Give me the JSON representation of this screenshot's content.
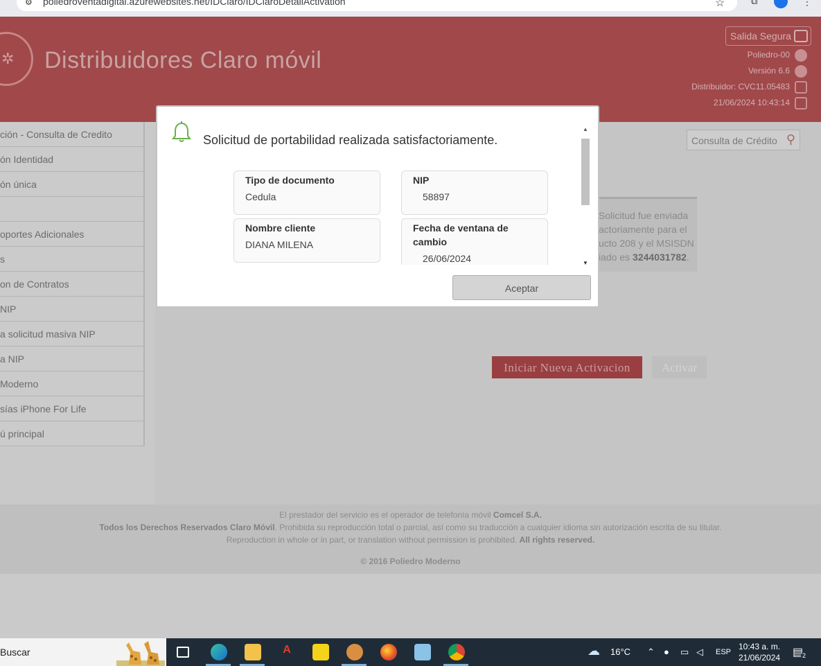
{
  "browser": {
    "url": "poliedroventadigital.azurewebsites.net/IDClaro/IDClaroDetailActivation"
  },
  "header": {
    "site_title": "Distribuidores Claro móvil",
    "logout_label": "Salida Segura",
    "info": [
      "Poliedro-00",
      "Versión 6.6",
      "Distribuidor: CVC11.05483",
      "21/06/2024 10:43:14"
    ]
  },
  "sidebar": {
    "items": [
      "ción - Consulta de Credito",
      "ón Identidad",
      "ón única",
      "",
      "oportes Adicionales",
      "s",
      "on de Contratos",
      " NIP",
      "a solicitud masiva NIP",
      "a NIP",
      " Moderno",
      "sías iPhone For Life",
      "ú principal"
    ]
  },
  "main": {
    "consulta_label": "Consulta de Crédito",
    "message_lines": [
      "Solicitud fue enviada",
      "actoriamente para el",
      "ucto 208 y el MSISDN"
    ],
    "message_prefix": "iado es ",
    "message_msisdn": "3244031782",
    "message_suffix": ".",
    "btn_iniciar": "Iniciar Nueva Activacion",
    "btn_activar": "Activar"
  },
  "footer": {
    "line1_text": "El prestador del servicio es el operador de telefonía móvil ",
    "line1_bold": "Comcel S.A.",
    "line2_bold": "Todos los Derechos Reservados Claro Móvil",
    "line2_text": ". Prohibida su reproducción total o parcial, así como su traducción a cualquier idioma sin autorización escrita de su titular.",
    "line3_text": "Reproduction in whole or in part, or translation without permission is prohibited. ",
    "line3_bold": "All rights reserved.",
    "copyright": "© 2016 Poliedro Moderno"
  },
  "modal": {
    "title": "Solicitud de portabilidad realizada satisfactoriamente.",
    "fields": [
      {
        "label": "Tipo de documento",
        "value": "Cedula"
      },
      {
        "label": "NIP",
        "value": "58897"
      },
      {
        "label": "Nombre cliente",
        "value": "DIANA MILENA"
      },
      {
        "label": "Fecha de ventana de cambio",
        "value": "26/06/2024"
      }
    ],
    "accept_label": "Aceptar"
  },
  "taskbar": {
    "search_label": "Buscar",
    "temperature": "16°C",
    "language": "ESP",
    "time": "10:43 a. m.",
    "date": "21/06/2024",
    "notifications": "2"
  }
}
